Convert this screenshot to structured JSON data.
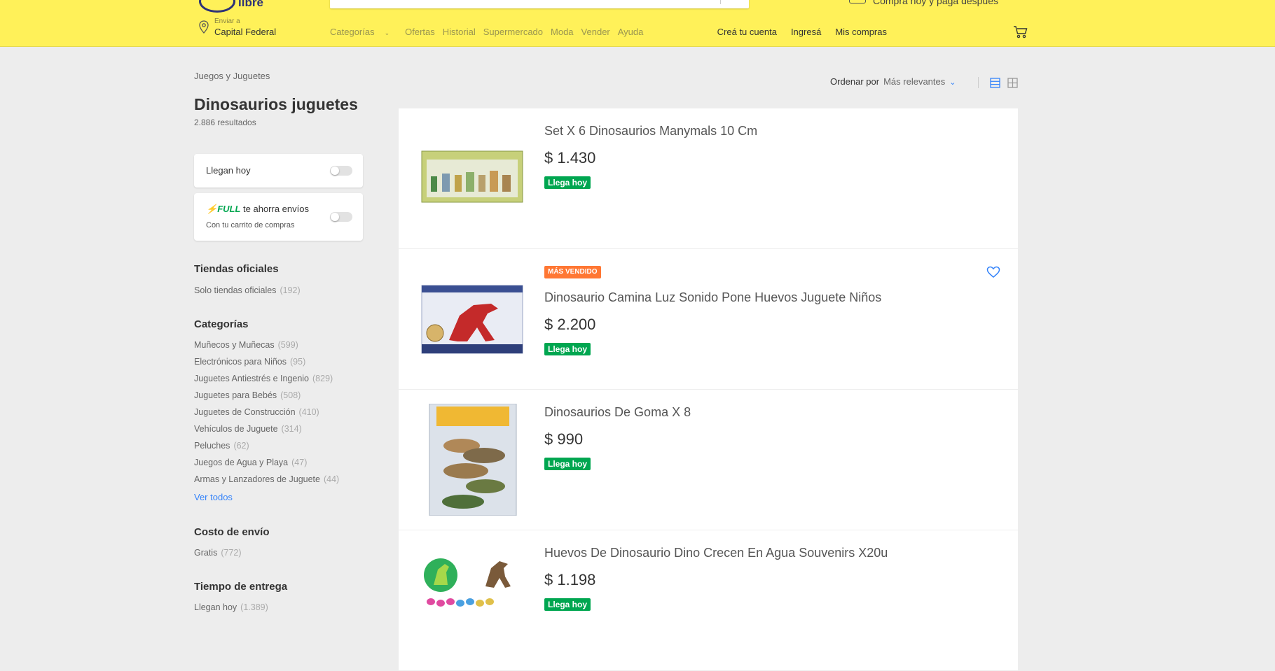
{
  "header": {
    "logo_text": "libre",
    "promo_text": "Comprá hoy y pagá después",
    "location_label": "Enviar a",
    "location_city": "Capital Federal",
    "nav": [
      "Categorías",
      "Ofertas",
      "Historial",
      "Supermercado",
      "Moda",
      "Vender",
      "Ayuda"
    ],
    "account_links": [
      "Creá tu cuenta",
      "Ingresá",
      "Mis compras"
    ]
  },
  "sidebar": {
    "breadcrumb": "Juegos y Juguetes",
    "title": "Dinosaurios juguetes",
    "results": "2.886 resultados",
    "filter_today": "Llegan hoy",
    "full_brand": "FULL",
    "full_text": "te ahorra envíos",
    "full_sub": "Con tu carrito de compras",
    "official_title": "Tiendas oficiales",
    "official_item": {
      "label": "Solo tiendas oficiales",
      "count": "(192)"
    },
    "categories_title": "Categorías",
    "categories": [
      {
        "label": "Muñecos y Muñecas",
        "count": "(599)"
      },
      {
        "label": "Electrónicos para Niños",
        "count": "(95)"
      },
      {
        "label": "Juguetes Antiestrés e Ingenio",
        "count": "(829)"
      },
      {
        "label": "Juguetes para Bebés",
        "count": "(508)"
      },
      {
        "label": "Juguetes de Construcción",
        "count": "(410)"
      },
      {
        "label": "Vehículos de Juguete",
        "count": "(314)"
      },
      {
        "label": "Peluches",
        "count": "(62)"
      },
      {
        "label": "Juegos de Agua y Playa",
        "count": "(47)"
      },
      {
        "label": "Armas y Lanzadores de Juguete",
        "count": "(44)"
      }
    ],
    "see_all": "Ver todos",
    "shipping_title": "Costo de envío",
    "shipping_item": {
      "label": "Gratis",
      "count": "(772)"
    },
    "delivery_title": "Tiempo de entrega",
    "delivery_item": {
      "label": "Llegan hoy",
      "count": "(1.389)"
    }
  },
  "sort": {
    "label": "Ordenar por",
    "value": "Más relevantes"
  },
  "items": [
    {
      "title": "Set X 6 Dinosaurios Manymals 10 Cm",
      "price": "$ 1.430",
      "badge": "Llega hoy"
    },
    {
      "title": "Dinosaurio Camina Luz Sonido Pone Huevos Juguete Niños",
      "price": "$ 2.200",
      "badge": "Llega hoy",
      "top": "MÁS VENDIDO"
    },
    {
      "title": "Dinosaurios De Goma X 8",
      "price": "$ 990",
      "badge": "Llega hoy"
    },
    {
      "title": "Huevos De Dinosaurio Dino Crecen En Agua Souvenirs X20u",
      "price": "$ 1.198",
      "badge": "Llega hoy"
    }
  ],
  "colors": {
    "header": "#fff159",
    "accent": "#3483fa",
    "green": "#00a650",
    "orange": "#ff7733"
  }
}
